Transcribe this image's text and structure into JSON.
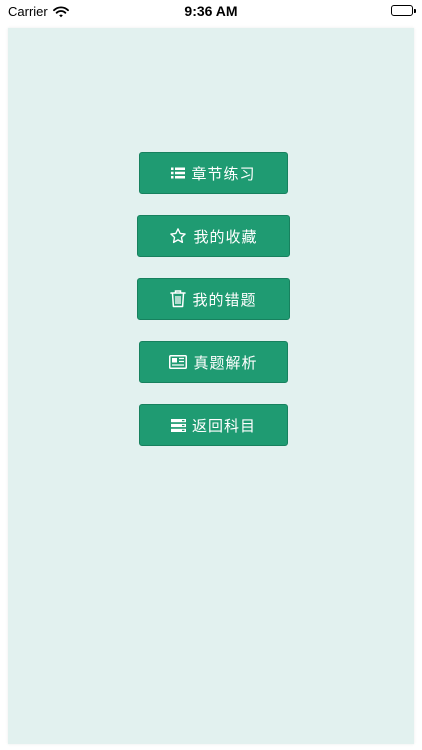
{
  "status_bar": {
    "carrier": "Carrier",
    "time": "9:36 AM",
    "icons": [
      "wifi-icon",
      "battery-icon"
    ]
  },
  "colors": {
    "background": "#e2f1ef",
    "button": "#1f9b72",
    "button_text": "#ffffff"
  },
  "menu": {
    "items": [
      {
        "label": "章节练习",
        "icon": "list-icon"
      },
      {
        "label": "我的收藏",
        "icon": "star-icon"
      },
      {
        "label": "我的错题",
        "icon": "trash-icon"
      },
      {
        "label": "真题解析",
        "icon": "newspaper-icon"
      },
      {
        "label": "返回科目",
        "icon": "stack-icon"
      }
    ]
  }
}
